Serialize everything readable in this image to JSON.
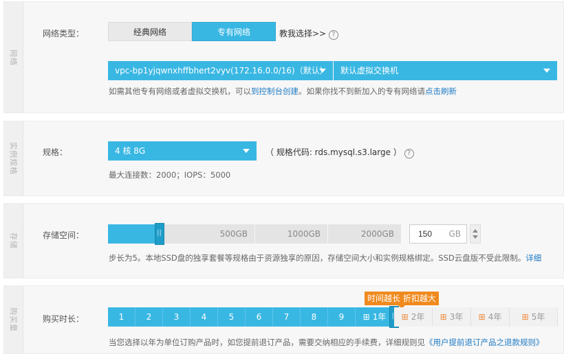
{
  "network": {
    "side_label": "网络",
    "type_label": "网络类型：",
    "tabs": [
      "经典网络",
      "专有网络"
    ],
    "help_link": "教我选择>>",
    "vpc_select": "vpc-bp1yjqwnxhffbhert2vyv(172.16.0.0/16)（默认）",
    "vswitch_select": "默认虚拟交换机",
    "hint_pre": "如需其他专有网络或者虚拟交换机，可以",
    "hint_link1": "到控制台创建",
    "hint_mid": "。如果你找不到新加入的专有网络请",
    "hint_link2": "点击刷新"
  },
  "spec": {
    "side_label": "实例规格",
    "label": "规格：",
    "select": "4 核 8G",
    "code_text": "（ 规格代码: rds.mysql.s3.large ）",
    "hint": "最大连接数：2000；IOPS：5000"
  },
  "storage": {
    "side_label": "存储",
    "label": "存储空间：",
    "ticks": [
      "500GB",
      "1000GB",
      "2000GB"
    ],
    "value": "150",
    "unit": "GB",
    "level_fraction": 0.175,
    "hint": "步长为5。本地SSD盘的独享套餐等规格由于资源独享的原因，存储空间大小和实例规格绑定。SSD云盘版不受此限制。",
    "hint_link": "详细"
  },
  "duration": {
    "side_label": "购买量",
    "label": "购买时长：",
    "promo": "时间越长 折扣越大",
    "months": [
      "1",
      "2",
      "3",
      "4",
      "5",
      "6",
      "7",
      "8",
      "9"
    ],
    "years": [
      "1年",
      "2年",
      "3年",
      "4年",
      "5年"
    ],
    "selected": "1年",
    "hint": "当您选择以年为单位订购产品时，如您提前退订产品，需要交纳相应的手续费，详细规则见",
    "hint_link": "《用户提前退订产品之退款规则》"
  },
  "colors": {
    "accent": "#39b7e3",
    "promo": "#f08a1e",
    "link": "#1e7ac3"
  }
}
